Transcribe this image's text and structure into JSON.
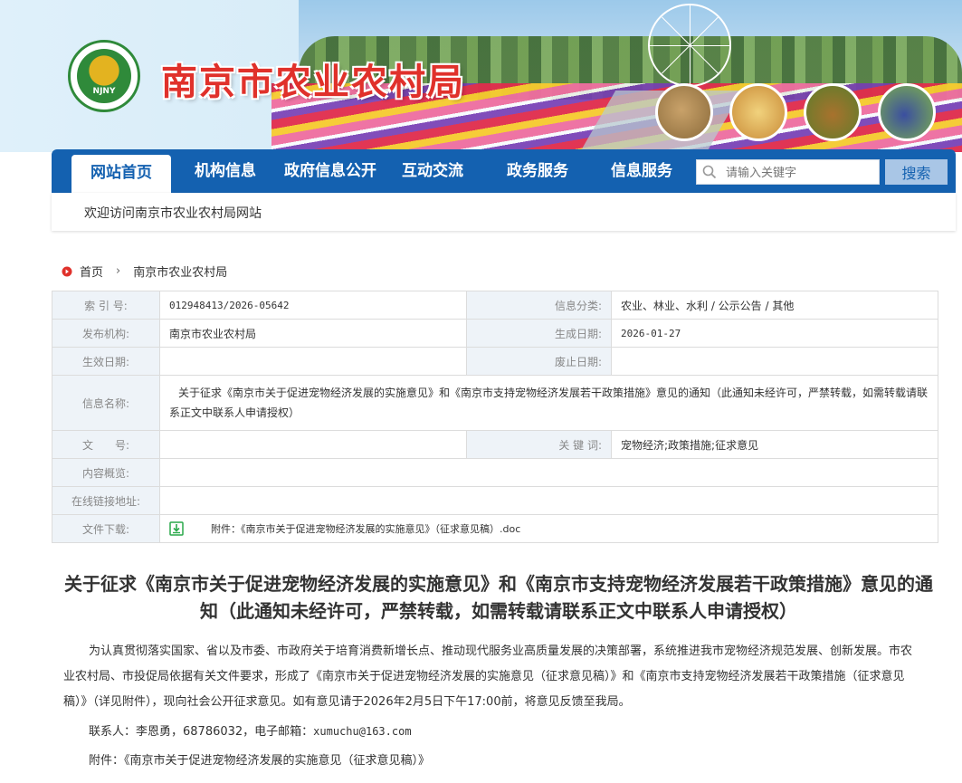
{
  "site": {
    "title": "南京市农业农村局",
    "logo_text": "NJNY"
  },
  "nav": {
    "items": [
      "网站首页",
      "机构信息",
      "政府信息公开",
      "互动交流",
      "政务服务",
      "信息服务"
    ],
    "active_index": 0,
    "search_placeholder": "请输入关键字",
    "search_button": "搜索",
    "welcome": "欢迎访问南京市农业农村局网站"
  },
  "breadcrumb": {
    "home": "首页",
    "separator": "›",
    "current": "南京市农业农村局"
  },
  "info": {
    "index_label": "索 引 号:",
    "index_value": "012948413/2026-05642",
    "category_label": "信息分类:",
    "category_value": "农业、林业、水利 / 公示公告 / 其他",
    "publisher_label": "发布机构:",
    "publisher_value": "南京市农业农村局",
    "generated_label": "生成日期:",
    "generated_value": "2026-01-27",
    "effective_label": "生效日期:",
    "effective_value": "",
    "abolished_label": "废止日期:",
    "abolished_value": "",
    "name_label": "信息名称:",
    "name_value": "关于征求《南京市关于促进宠物经济发展的实施意见》和《南京市支持宠物经济发展若干政策措施》意见的通知（此通知未经许可，严禁转载，如需转载请联系正文中联系人申请授权）",
    "docno_label": "文　　号:",
    "docno_value": "",
    "keywords_label": "关 键 词:",
    "keywords_value": "宠物经济;政策措施;征求意见",
    "overview_label": "内容概览:",
    "overview_value": "",
    "link_label": "在线链接地址:",
    "link_value": "",
    "download_label": "文件下载:",
    "download_value": "附件：《南京市关于促进宠物经济发展的实施意见》（征求意见稿）.doc"
  },
  "article": {
    "title": "关于征求《南京市关于促进宠物经济发展的实施意见》和《南京市支持宠物经济发展若干政策措施》意见的通知（此通知未经许可，严禁转载，如需转载请联系正文中联系人申请授权）",
    "paragraph": "为认真贯彻落实国家、省以及市委、市政府关于培育消费新增长点、推动现代服务业高质量发展的决策部署，系统推进我市宠物经济规范发展、创新发展。市农业农村局、市投促局依据有关文件要求，形成了《南京市关于促进宠物经济发展的实施意见（征求意见稿）》和《南京市支持宠物经济发展若干政策措施（征求意见稿）》（详见附件），现向社会公开征求意见。如有意见请于2026年2月5日下午17:00前，将意见反馈至我局。",
    "contact_prefix": "联系人：李恩勇，68786032，电子邮箱：",
    "contact_email": "xumuchu@163.com",
    "attachment": "附件：《南京市关于促进宠物经济发展的实施意见（征求意见稿）》"
  },
  "colors": {
    "nav_blue": "#1461b0",
    "title_red": "#e0312b",
    "label_bg": "#eef3f8"
  },
  "icons": [
    "search-icon",
    "home-icon",
    "download-icon"
  ]
}
